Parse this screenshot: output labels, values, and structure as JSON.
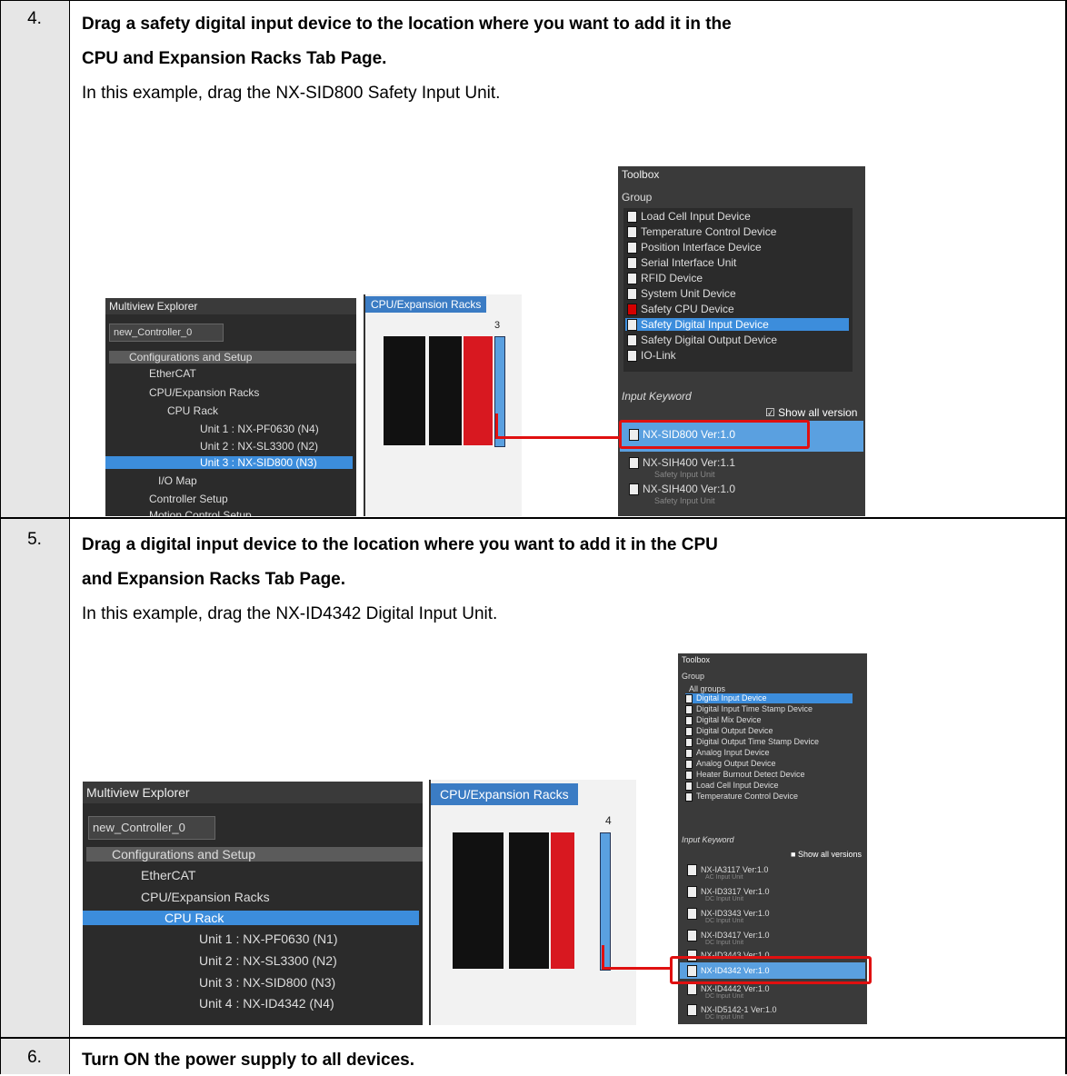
{
  "steps": [
    {
      "num": "4.",
      "heading_line1": "Drag a safety digital input device to the location where you want to add it in the",
      "heading_line2": "CPU and Expansion Racks Tab Page.",
      "body": "In this example, drag the NX-SID800 Safety Input Unit."
    },
    {
      "num": "5.",
      "heading_line1": "Drag a digital input device to the location where you want to add it in the CPU",
      "heading_line2": "and Expansion Racks Tab Page.",
      "body": "In this example, drag the NX-ID4342 Digital Input Unit."
    },
    {
      "num": "6.",
      "heading_line1": "Turn ON the power supply to all devices."
    }
  ],
  "shot1": {
    "explorer": {
      "title": "Multiview Explorer",
      "controller": "new_Controller_0",
      "tree": [
        "Configurations and Setup",
        "EtherCAT",
        "CPU/Expansion Racks",
        "CPU Rack",
        "Unit 1 : NX-PF0630 (N4)",
        "Unit 2 : NX-SL3300 (N2)",
        "Unit 3 : NX-SID800 (N3)",
        "I/O Map",
        "Controller Setup",
        "Motion Control Setup"
      ]
    },
    "tab": {
      "title": "CPU/Expansion Racks",
      "slot": "3"
    },
    "toolbox": {
      "title": "Toolbox",
      "group_label": "Group",
      "groups": [
        "Load Cell Input Device",
        "Temperature Control Device",
        "Position Interface Device",
        "Serial Interface Unit",
        "RFID Device",
        "System Unit Device",
        "Safety CPU Device",
        "Safety Digital Input Device",
        "Safety Digital Output Device",
        "IO-Link"
      ],
      "keyword_label": "Input Keyword",
      "show_all": "Show all version",
      "items": [
        {
          "name": "NX-SID800 Ver:1.0",
          "desc": ""
        },
        {
          "name": "NX-SIH400 Ver:1.1",
          "desc": "Safety Input Unit"
        },
        {
          "name": "NX-SIH400 Ver:1.0",
          "desc": "Safety Input Unit"
        }
      ]
    }
  },
  "shot2": {
    "explorer": {
      "title": "Multiview Explorer",
      "controller": "new_Controller_0",
      "tree": [
        "Configurations and Setup",
        "EtherCAT",
        "CPU/Expansion Racks",
        "CPU Rack",
        "Unit 1 : NX-PF0630 (N1)",
        "Unit 2 : NX-SL3300 (N2)",
        "Unit 3 : NX-SID800 (N3)",
        "Unit 4 : NX-ID4342 (N4)"
      ]
    },
    "tab": {
      "title": "CPU/Expansion Racks",
      "slot": "4"
    },
    "toolbox": {
      "title": "Toolbox",
      "group_label": "Group",
      "groups": [
        "All groups",
        "Digital Input Device",
        "Digital Input Time Stamp Device",
        "Digital Mix Device",
        "Digital Output Device",
        "Digital Output Time Stamp Device",
        "Analog Input Device",
        "Analog Output Device",
        "Heater Burnout Detect Device",
        "Load Cell Input Device",
        "Temperature Control Device"
      ],
      "keyword_label": "Input Keyword",
      "show_all": "Show all versions",
      "items": [
        {
          "name": "NX-IA3117 Ver:1.0",
          "desc": "AC Input Unit"
        },
        {
          "name": "NX-ID3317 Ver:1.0",
          "desc": "DC Input Unit"
        },
        {
          "name": "NX-ID3343 Ver:1.0",
          "desc": "DC Input Unit"
        },
        {
          "name": "NX-ID3417 Ver:1.0",
          "desc": "DC Input Unit"
        },
        {
          "name": "NX-ID3443 Ver:1.0",
          "desc": ""
        },
        {
          "name": "NX-ID4342 Ver:1.0",
          "desc": ""
        },
        {
          "name": "NX-ID4442 Ver:1.0",
          "desc": "DC Input Unit"
        },
        {
          "name": "NX-ID5142-1 Ver:1.0",
          "desc": "DC Input Unit"
        }
      ]
    }
  },
  "colors": {
    "highlight": "#3c8ddc",
    "callout": "#e01010",
    "num_cell": "#e6e6e6"
  }
}
